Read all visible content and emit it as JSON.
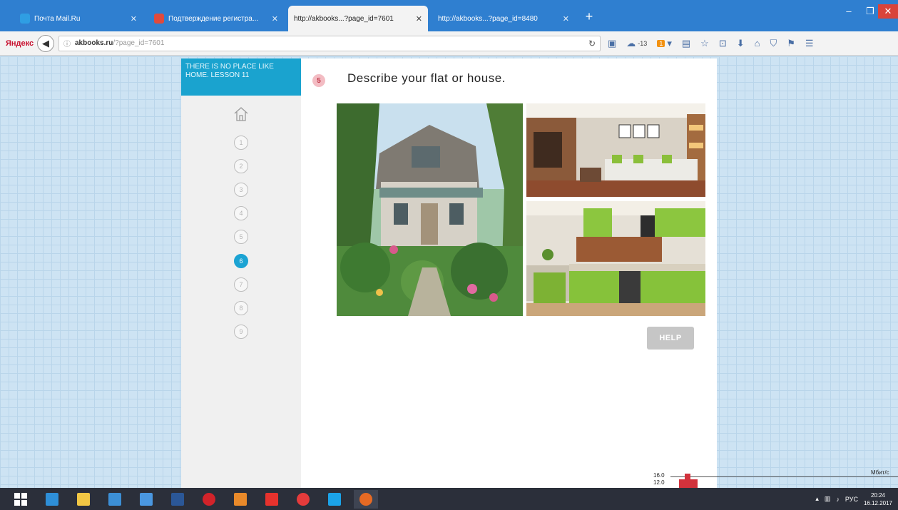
{
  "browser": {
    "tabs": [
      {
        "title": "Почта Mail.Ru",
        "active": false,
        "favicon_color": "#2f9ee3"
      },
      {
        "title": "Подтверждение регистра...",
        "active": false,
        "favicon_color": "#e04a3c"
      },
      {
        "title": "http://akbooks...?page_id=7601",
        "active": true,
        "favicon_color": "#bbbbbb"
      },
      {
        "title": "http://akbooks...?page_id=8480",
        "active": false,
        "favicon_color": "#bbbbbb"
      }
    ],
    "new_tab": "+",
    "brand": "Яндекс",
    "address": {
      "host": "akbooks.ru",
      "path": "/?page_id=7601"
    },
    "toolbar": {
      "rating": "-13",
      "badge": "1"
    }
  },
  "lesson": {
    "title": "THERE IS NO PLACE LIKE HOME. Lesson 11",
    "steps": [
      "1",
      "2",
      "3",
      "4",
      "5",
      "6",
      "7",
      "8",
      "9"
    ],
    "active_step": "6"
  },
  "task": {
    "number": "5",
    "prompt": "Describe your flat or house.",
    "help_label": "HELP"
  },
  "overlay": {
    "label_top": "16.0",
    "label_bottom": "12.0",
    "label_right": "Мбит/с"
  },
  "taskbar": {
    "lang": "РУС",
    "time": "20:24",
    "date": "16.12.2017"
  },
  "colors": {
    "accent": "#1aa3cf",
    "task_badge": "#f3bcc3",
    "help_button": "#c6c6c6"
  }
}
